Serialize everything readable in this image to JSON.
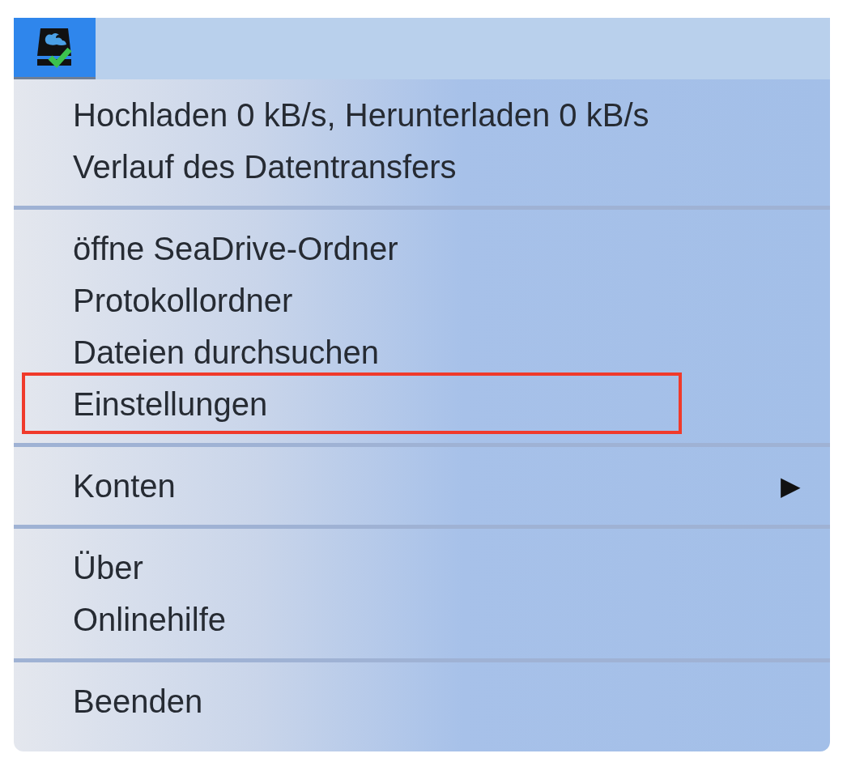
{
  "menu_bar": {
    "status_icon": {
      "selected": true
    }
  },
  "menu": {
    "groups": [
      {
        "items": [
          {
            "label": "Hochladen 0 kB/s, Herunterladen 0 kB/s",
            "highlighted": false
          },
          {
            "label": "Verlauf des Datentransfers",
            "highlighted": false
          }
        ]
      },
      {
        "items": [
          {
            "label": "öffne SeaDrive-Ordner",
            "highlighted": false
          },
          {
            "label": "Protokollordner",
            "highlighted": false
          },
          {
            "label": "Dateien durchsuchen",
            "highlighted": false
          },
          {
            "label": "Einstellungen",
            "highlighted": true
          }
        ]
      },
      {
        "items": [
          {
            "label": "Konten",
            "highlighted": false,
            "submenu_arrow": "▶"
          }
        ]
      },
      {
        "items": [
          {
            "label": "Über",
            "highlighted": false
          },
          {
            "label": "Onlinehilfe",
            "highlighted": false
          }
        ]
      },
      {
        "items": [
          {
            "label": "Beenden",
            "highlighted": false
          }
        ]
      }
    ]
  }
}
